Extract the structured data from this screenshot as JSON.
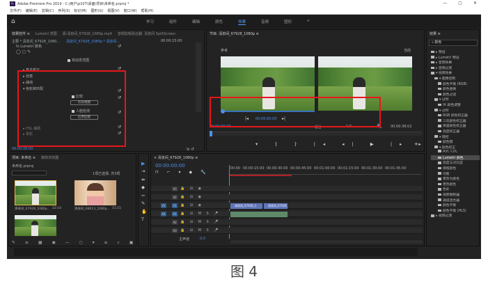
{
  "window": {
    "title": "Adobe Premiere Pro 2019 - C:\\用户\\p107\\桌面\\项目\\未命名.prproj *",
    "controls": [
      "—",
      "▢",
      "✕"
    ]
  },
  "menu": [
    "文件(F)",
    "编辑(E)",
    "剪辑(C)",
    "序列(S)",
    "标记(M)",
    "图形(G)",
    "视图(V)",
    "窗口(W)",
    "帮助(H)"
  ],
  "workspace": {
    "tabs": [
      "学习",
      "组件",
      "编辑",
      "颜色",
      "效果",
      "音频",
      "图形"
    ],
    "active": "效果",
    "more": "»"
  },
  "effect_controls": {
    "tabs": [
      "效果控件 ≡",
      "Lumetri 范围",
      "源:清泉间_67928_1080p.mp4",
      "音频剪辑混合器: 清泉间 SplitScreen"
    ],
    "header_left": "主要 * 清泉间_67928_1080...",
    "header_right": "清泉间_67928_1080p * 清泉间...",
    "timecode_top": "00:00:15:00",
    "fx_label": "fx Lumetri 颜色",
    "hdr_label": "高动态范围",
    "items": [
      "▸ 基本校正",
      "▸ 创意",
      "▸ 曲线",
      "▾ 色轮和匹配"
    ],
    "compare_label": "比较",
    "compare_button": "比较视图",
    "face_label": "人脸检测",
    "apply_button": "应用匹配",
    "hsl_label": "▸ HSL 辅助",
    "vignette_label": "▸ 晕影",
    "timecode_bottom": "00:00:00:00"
  },
  "program_monitor": {
    "tab": "节目: 清泉间_67928_1080p ≡",
    "reference_label": "参考",
    "current_label": "当前",
    "ref_time": "00:00:00:00",
    "time_left": "00:00:00:00",
    "fit": "适合",
    "ratio": "1/2",
    "time_right": "00:00:38:02"
  },
  "project": {
    "tabs": [
      "项目: 未命名 ≡",
      "媒体浏览器"
    ],
    "file": "未命名.prproj",
    "selected": "1项已选择, 共3项",
    "items": [
      {
        "name": "清泉间_67928_1080p...",
        "duration": "22:14"
      },
      {
        "name": "清泉间_68013_1080p...",
        "duration": "11:15"
      }
    ]
  },
  "timeline": {
    "tab": "× 清泉间_67928_1080p ≡",
    "timecode": "00:00:00:00",
    "ruler": [
      ":00:00",
      "00:00:15:00",
      "00:00:30:00",
      "00:00:45:00",
      "00:01:00:00",
      "00:01:15:00",
      "00:01:30:00",
      "00:01:45:00"
    ],
    "tracks": [
      "V3",
      "V2",
      "V1",
      "A1",
      "A2",
      "A3"
    ],
    "master": "主声道",
    "master_value": "0.0",
    "clip_v1a": "清泉间_67928_1",
    "clip_v1b": "清泉间_67928_1080p"
  },
  "effects_panel": {
    "tab": "效果 ≡",
    "search": "颜色",
    "items": [
      {
        "label": "▸ 预设",
        "depth": 0
      },
      {
        "label": "▸ Lumetri 预设",
        "depth": 0
      },
      {
        "label": "▸ 音频效果",
        "depth": 0
      },
      {
        "label": "▸ 音频过渡",
        "depth": 0
      },
      {
        "label": "▾ 视频效果",
        "depth": 0
      },
      {
        "label": "▾ 图像控制",
        "depth": 1
      },
      {
        "label": "颜色平衡 (RGB)",
        "depth": 2
      },
      {
        "label": "颜色替换",
        "depth": 2
      },
      {
        "label": "颜色过滤",
        "depth": 2
      },
      {
        "label": "▾ 过时",
        "depth": 1
      },
      {
        "label": "Vt 颜色调整",
        "depth": 2
      },
      {
        "label": "▾ 过时",
        "depth": 1
      },
      {
        "label": "RGB 颜色校正器",
        "depth": 2
      },
      {
        "label": "三向颜色校正器",
        "depth": 2
      },
      {
        "label": "快速颜色校正器",
        "depth": 2
      },
      {
        "label": "亮度校正器",
        "depth": 2
      },
      {
        "label": "▾ 键控",
        "depth": 1
      },
      {
        "label": "颜色键",
        "depth": 2
      },
      {
        "label": "▾ 颜色校正",
        "depth": 1
      },
      {
        "label": "ASC CDL",
        "depth": 2
      },
      {
        "label": "Lumetri 颜色",
        "depth": 2
      },
      {
        "label": "亮度与对比度",
        "depth": 2
      },
      {
        "label": "保留颜色",
        "depth": 2
      },
      {
        "label": "均衡",
        "depth": 2
      },
      {
        "label": "更改为颜色",
        "depth": 2
      },
      {
        "label": "更改颜色",
        "depth": 2
      },
      {
        "label": "色彩",
        "depth": 2
      },
      {
        "label": "视频限制器",
        "depth": 2
      },
      {
        "label": "通道混合器",
        "depth": 2
      },
      {
        "label": "颜色平衡",
        "depth": 2
      },
      {
        "label": "颜色平衡 (HLS)",
        "depth": 2
      },
      {
        "label": "▸ 视频过渡",
        "depth": 0
      }
    ],
    "selected_index": 20
  },
  "caption": "图 4",
  "colors": {
    "accent": "#4d8fea",
    "highlight": "#e8161a"
  }
}
